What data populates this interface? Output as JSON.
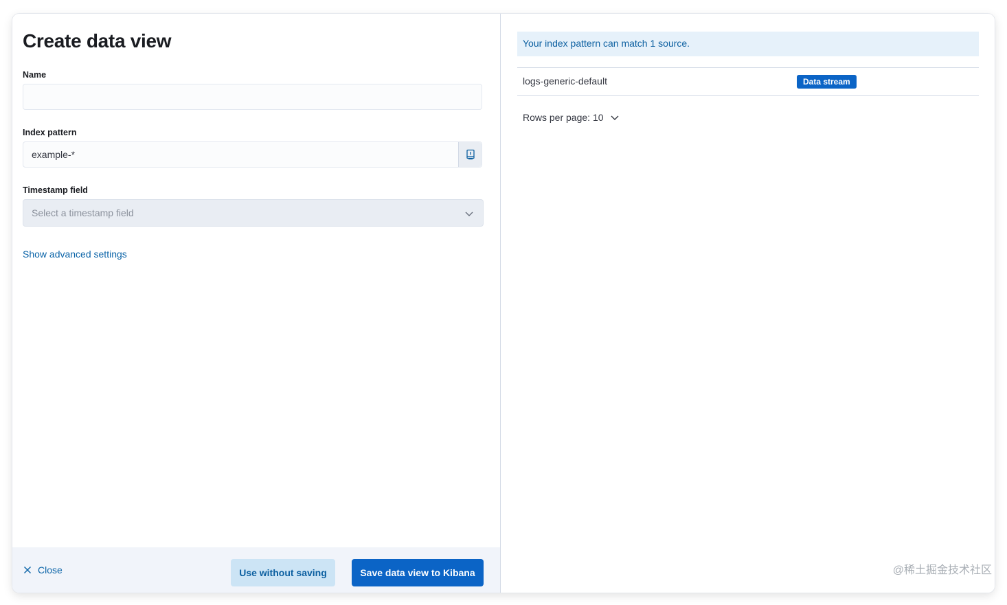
{
  "form": {
    "title": "Create data view",
    "name_label": "Name",
    "name_value": "",
    "index_pattern_label": "Index pattern",
    "index_pattern_value": "example-*",
    "timestamp_label": "Timestamp field",
    "timestamp_placeholder": "Select a timestamp field",
    "advanced_link": "Show advanced settings"
  },
  "footer": {
    "close_label": "Close",
    "use_without_saving_label": "Use without saving",
    "save_label": "Save data view to Kibana"
  },
  "matches": {
    "callout": "Your index pattern can match 1 source.",
    "rows": [
      {
        "name": "logs-generic-default",
        "type": "Data stream"
      }
    ],
    "rows_per_page_label": "Rows per page: 10"
  },
  "icons": {
    "index_pattern_append": "help-book-icon",
    "select_chevron": "chevron-down-icon",
    "close": "close-icon",
    "pagination_chevron": "chevron-down-icon"
  },
  "colors": {
    "primary": "#0b64c6",
    "link": "#0b64a8",
    "callout_bg": "#e6f1fa",
    "footer_bg": "#f1f4fa"
  },
  "watermark": "@稀土掘金技术社区"
}
